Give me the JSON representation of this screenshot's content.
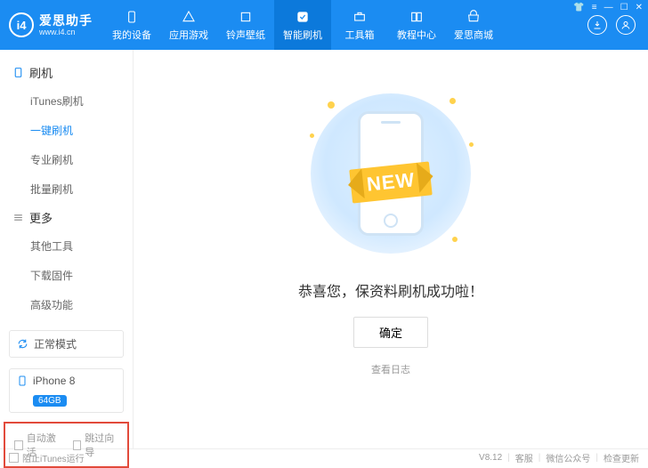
{
  "logo": {
    "badge": "i4",
    "title": "爱思助手",
    "url": "www.i4.cn"
  },
  "nav": [
    {
      "label": "我的设备"
    },
    {
      "label": "应用游戏"
    },
    {
      "label": "铃声壁纸"
    },
    {
      "label": "智能刷机"
    },
    {
      "label": "工具箱"
    },
    {
      "label": "教程中心"
    },
    {
      "label": "爱思商城"
    }
  ],
  "sidebar": {
    "group1": {
      "title": "刷机",
      "items": [
        "iTunes刷机",
        "一键刷机",
        "专业刷机",
        "批量刷机"
      ]
    },
    "group2": {
      "title": "更多",
      "items": [
        "其他工具",
        "下载固件",
        "高级功能"
      ]
    },
    "mode": "正常模式",
    "phone": {
      "name": "iPhone 8",
      "storage": "64GB"
    },
    "opts": {
      "auto_activate": "自动激活",
      "skip_guide": "跳过向导"
    }
  },
  "main": {
    "ribbon": "NEW",
    "success": "恭喜您，保资料刷机成功啦！",
    "ok": "确定",
    "log": "查看日志"
  },
  "footer": {
    "block_itunes": "阻止iTunes运行",
    "version": "V8.12",
    "support": "客服",
    "wechat": "微信公众号",
    "update": "检查更新"
  }
}
